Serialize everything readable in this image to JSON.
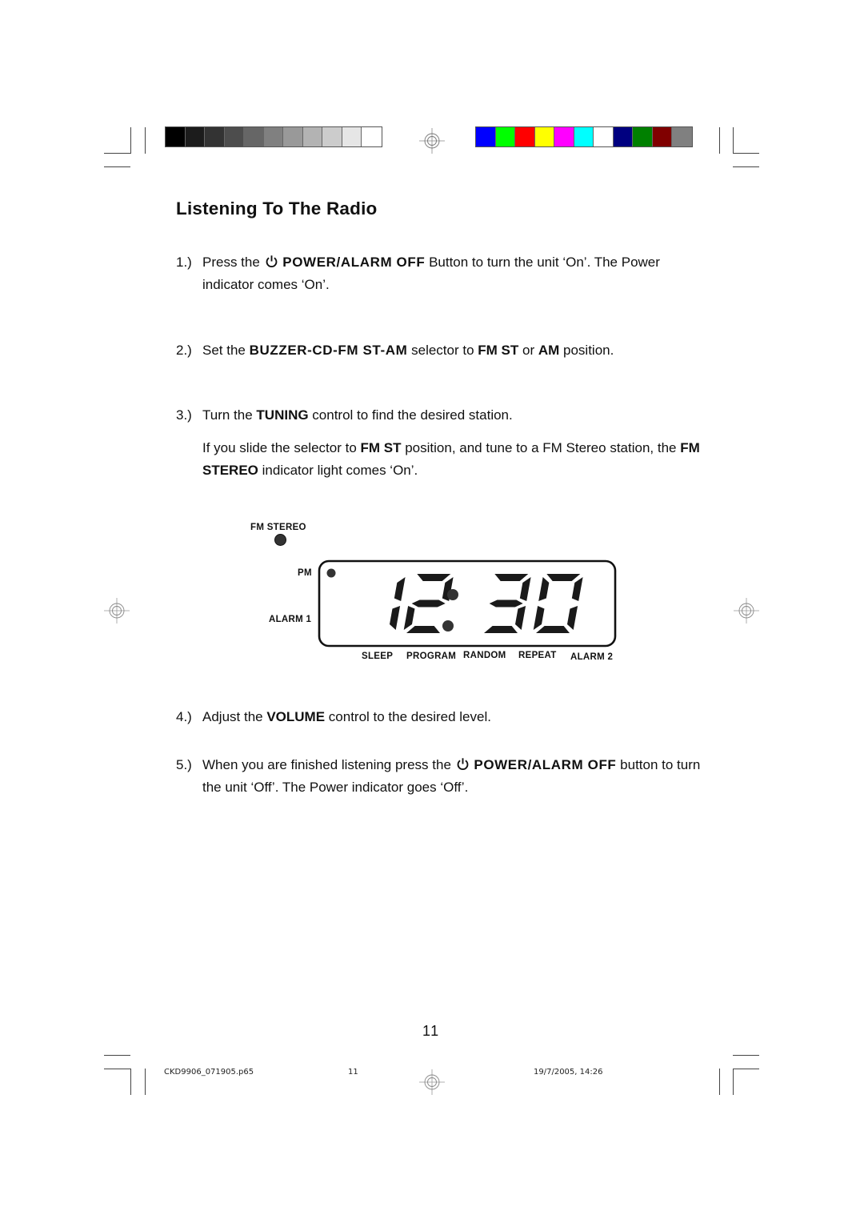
{
  "print_marks": {
    "grayscale_swatches": [
      "#000000",
      "#1c1c1c",
      "#333333",
      "#4d4d4d",
      "#666666",
      "#808080",
      "#999999",
      "#b3b3b3",
      "#cccccc",
      "#e6e6e6",
      "#ffffff"
    ],
    "color_swatches": [
      "#0000ff",
      "#00ff00",
      "#ff0000",
      "#ffff00",
      "#ff00ff",
      "#00ffff",
      "#ffffff",
      "#000080",
      "#008000",
      "#800000",
      "#808080"
    ]
  },
  "page": {
    "title": "Listening To The Radio",
    "steps": [
      {
        "num": "1.)",
        "parts": [
          "Press the",
          "POWER/ALARM OFF",
          "Button to turn the unit ‘On’. The Power indicator comes ‘On’."
        ],
        "icon": "power-icon"
      },
      {
        "num": "2.)",
        "parts": [
          "Set the ",
          "BUZZER-CD-FM ST-AM",
          " selector to ",
          "FM ST",
          " or ",
          "AM",
          " position."
        ]
      },
      {
        "num": "3.)",
        "parts": [
          "Turn the ",
          "TUNING",
          " control to find the desired station."
        ],
        "note_parts": [
          "If you slide the selector to ",
          "FM ST",
          " position, and tune to a FM Stereo station, the ",
          "FM STEREO",
          " indicator light comes ‘On’."
        ]
      },
      {
        "num": "4.)",
        "parts": [
          "Adjust the ",
          "VOLUME",
          " control to the desired level."
        ]
      },
      {
        "num": "5.)",
        "parts": [
          "When you are finished listening press the",
          "POWER/ALARM OFF",
          "button to turn the unit ‘Off’. The Power indicator goes ‘Off’."
        ],
        "icon": "power-icon"
      }
    ],
    "page_number": "11"
  },
  "display": {
    "time": "12:30",
    "labels": {
      "fm_stereo": "FM STEREO",
      "pm": "PM",
      "alarm1": "ALARM 1",
      "sleep": "SLEEP",
      "program": "PROGRAM",
      "random": "RANDOM",
      "repeat": "REPEAT",
      "alarm2": "ALARM 2"
    }
  },
  "footer": {
    "filename": "CKD9906_071905.p65",
    "page": "11",
    "datetime": "19/7/2005, 14:26"
  }
}
